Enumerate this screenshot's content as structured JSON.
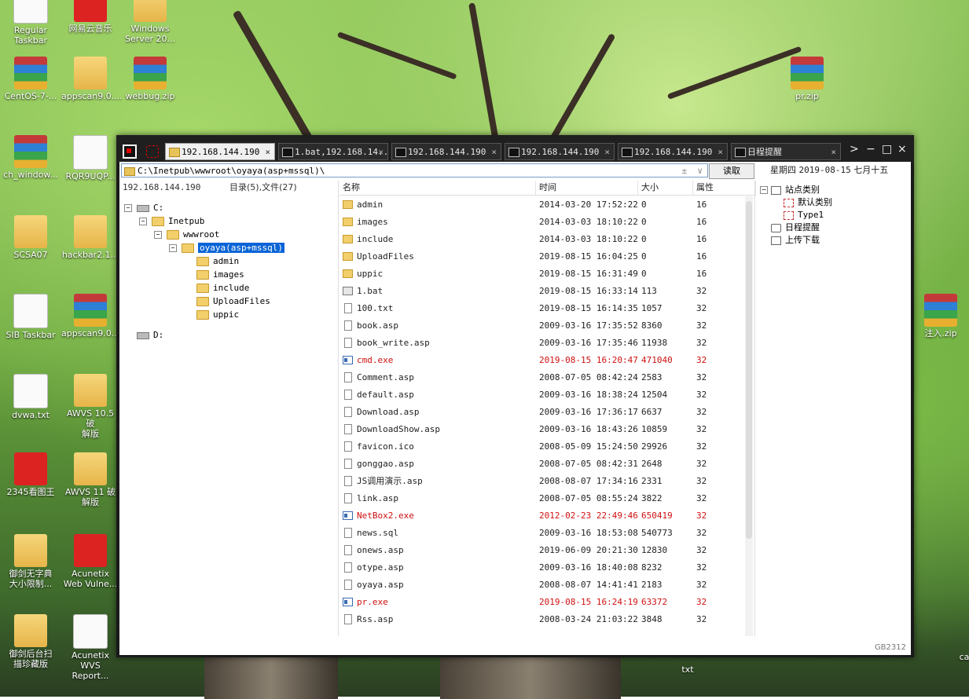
{
  "desktop": {
    "icons": [
      {
        "label": "Regular\nTaskbar",
        "kind": "doc"
      },
      {
        "label": "网易云音乐",
        "kind": "app"
      },
      {
        "label": "Windows\nServer 20...",
        "kind": "folder"
      },
      {
        "label": "CentOS-7-...",
        "kind": "rar"
      },
      {
        "label": "appscan9.0....",
        "kind": "folder"
      },
      {
        "label": "webbug.zip",
        "kind": "rar"
      },
      {
        "label": "pr.zip",
        "kind": "rar"
      },
      {
        "label": "ch_window...",
        "kind": "rar"
      },
      {
        "label": "RQR9UQP...",
        "kind": "doc"
      },
      {
        "label": "SCSA07",
        "kind": "folder"
      },
      {
        "label": "hackbar2.1...",
        "kind": "folder"
      },
      {
        "label": "SIB Taskbar",
        "kind": "doc"
      },
      {
        "label": "appscan9.0....",
        "kind": "rar"
      },
      {
        "label": "dvwa.txt",
        "kind": "doc"
      },
      {
        "label": "AWVS 10.5 破\n解版",
        "kind": "folder"
      },
      {
        "label": "2345看图王",
        "kind": "app"
      },
      {
        "label": "AWVS 11 破\n解版",
        "kind": "folder"
      },
      {
        "label": "御剑无字典\n大小限制...",
        "kind": "folder"
      },
      {
        "label": "Acunetix\nWeb Vulne...",
        "kind": "app"
      },
      {
        "label": "御剑后台扫\n描珍藏版",
        "kind": "folder"
      },
      {
        "label": "Acunetix\nWVS Report...",
        "kind": "doc"
      },
      {
        "label": "注入.zip",
        "kind": "rar"
      },
      {
        "label": "txt",
        "kind": "doc"
      },
      {
        "label": "ca",
        "kind": "doc"
      }
    ]
  },
  "window": {
    "tabs": [
      {
        "label": "192.168.144.190",
        "active": true
      },
      {
        "label": "1.bat,192.168.14...",
        "active": false
      },
      {
        "label": "192.168.144.190",
        "active": false
      },
      {
        "label": "192.168.144.190",
        "active": false
      },
      {
        "label": "192.168.144.190",
        "active": false
      },
      {
        "label": "日程提醒",
        "active": false
      }
    ],
    "tab_close": "×",
    "ctrl_next": ">",
    "ctrl_min": "−",
    "ctrl_max": "□",
    "ctrl_close": "×",
    "address": "C:\\Inetpub\\wwwroot\\oyaya(asp+mssql)\\",
    "read_button": "读取",
    "date_weekday": "星期四",
    "date_value": "2019-08-15",
    "date_lunar": "七月十五",
    "host": "192.168.144.190",
    "dir_summary": "目录(5),文件(27)",
    "status": "GB2312"
  },
  "tree": [
    {
      "label": "C:",
      "level": 0,
      "type": "drive",
      "exp": "−"
    },
    {
      "label": "Inetpub",
      "level": 1,
      "type": "folder",
      "exp": "−"
    },
    {
      "label": "wwwroot",
      "level": 2,
      "type": "folder",
      "exp": "−"
    },
    {
      "label": "oyaya(asp+mssql)",
      "level": 3,
      "type": "folder",
      "exp": "−",
      "selected": true
    },
    {
      "label": "admin",
      "level": 4,
      "type": "folder"
    },
    {
      "label": "images",
      "level": 4,
      "type": "folder"
    },
    {
      "label": "include",
      "level": 4,
      "type": "folder"
    },
    {
      "label": "UploadFiles",
      "level": 4,
      "type": "folder"
    },
    {
      "label": "uppic",
      "level": 4,
      "type": "folder"
    },
    {
      "label": "D:",
      "level": 0,
      "type": "drive"
    }
  ],
  "columns": {
    "name": "名称",
    "time": "时间",
    "size": "大小",
    "attr": "属性"
  },
  "files": [
    {
      "name": "admin",
      "time": "2014-03-20 17:52:22",
      "size": "0",
      "attr": "16",
      "type": "folder"
    },
    {
      "name": "images",
      "time": "2014-03-03 18:10:22",
      "size": "0",
      "attr": "16",
      "type": "folder"
    },
    {
      "name": "include",
      "time": "2014-03-03 18:10:22",
      "size": "0",
      "attr": "16",
      "type": "folder"
    },
    {
      "name": "UploadFiles",
      "time": "2019-08-15 16:04:25",
      "size": "0",
      "attr": "16",
      "type": "folder"
    },
    {
      "name": "uppic",
      "time": "2019-08-15 16:31:49",
      "size": "0",
      "attr": "16",
      "type": "folder"
    },
    {
      "name": "1.bat",
      "time": "2019-08-15 16:33:14",
      "size": "113",
      "attr": "32",
      "type": "bat"
    },
    {
      "name": "100.txt",
      "time": "2019-08-15 16:14:35",
      "size": "1057",
      "attr": "32",
      "type": "file"
    },
    {
      "name": "book.asp",
      "time": "2009-03-16 17:35:52",
      "size": "8360",
      "attr": "32",
      "type": "file"
    },
    {
      "name": "book_write.asp",
      "time": "2009-03-16 17:35:46",
      "size": "11938",
      "attr": "32",
      "type": "file"
    },
    {
      "name": "cmd.exe",
      "time": "2019-08-15 16:20:47",
      "size": "471040",
      "attr": "32",
      "type": "exe",
      "red": true
    },
    {
      "name": "Comment.asp",
      "time": "2008-07-05 08:42:24",
      "size": "2583",
      "attr": "32",
      "type": "file"
    },
    {
      "name": "default.asp",
      "time": "2009-03-16 18:38:24",
      "size": "12504",
      "attr": "32",
      "type": "file"
    },
    {
      "name": "Download.asp",
      "time": "2009-03-16 17:36:17",
      "size": "6637",
      "attr": "32",
      "type": "file"
    },
    {
      "name": "DownloadShow.asp",
      "time": "2009-03-16 18:43:26",
      "size": "10859",
      "attr": "32",
      "type": "file"
    },
    {
      "name": "favicon.ico",
      "time": "2008-05-09 15:24:50",
      "size": "29926",
      "attr": "32",
      "type": "file"
    },
    {
      "name": "gonggao.asp",
      "time": "2008-07-05 08:42:31",
      "size": "2648",
      "attr": "32",
      "type": "file"
    },
    {
      "name": "JS调用演示.asp",
      "time": "2008-08-07 17:34:16",
      "size": "2331",
      "attr": "32",
      "type": "file"
    },
    {
      "name": "link.asp",
      "time": "2008-07-05 08:55:24",
      "size": "3822",
      "attr": "32",
      "type": "file"
    },
    {
      "name": "NetBox2.exe",
      "time": "2012-02-23 22:49:46",
      "size": "650419",
      "attr": "32",
      "type": "exe",
      "red": true
    },
    {
      "name": "news.sql",
      "time": "2009-03-16 18:53:08",
      "size": "540773",
      "attr": "32",
      "type": "file"
    },
    {
      "name": "onews.asp",
      "time": "2019-06-09 20:21:30",
      "size": "12830",
      "attr": "32",
      "type": "file"
    },
    {
      "name": "otype.asp",
      "time": "2009-03-16 18:40:08",
      "size": "8232",
      "attr": "32",
      "type": "file"
    },
    {
      "name": "oyaya.asp",
      "time": "2008-08-07 14:41:41",
      "size": "2183",
      "attr": "32",
      "type": "file"
    },
    {
      "name": "pr.exe",
      "time": "2019-08-15 16:24:19",
      "size": "63372",
      "attr": "32",
      "type": "exe",
      "red": true
    },
    {
      "name": "Rss.asp",
      "time": "2008-03-24 21:03:22",
      "size": "3848",
      "attr": "32",
      "type": "file"
    }
  ],
  "sidebar": [
    {
      "label": "站点类别",
      "level": 0,
      "exp": "−",
      "box": "normal"
    },
    {
      "label": "默认类别",
      "level": 1,
      "box": "red"
    },
    {
      "label": "Type1",
      "level": 1,
      "box": "red",
      "mono": true
    },
    {
      "label": "日程提醒",
      "level": 0,
      "box": "clock"
    },
    {
      "label": "上传下载",
      "level": 0,
      "box": "normal"
    }
  ]
}
